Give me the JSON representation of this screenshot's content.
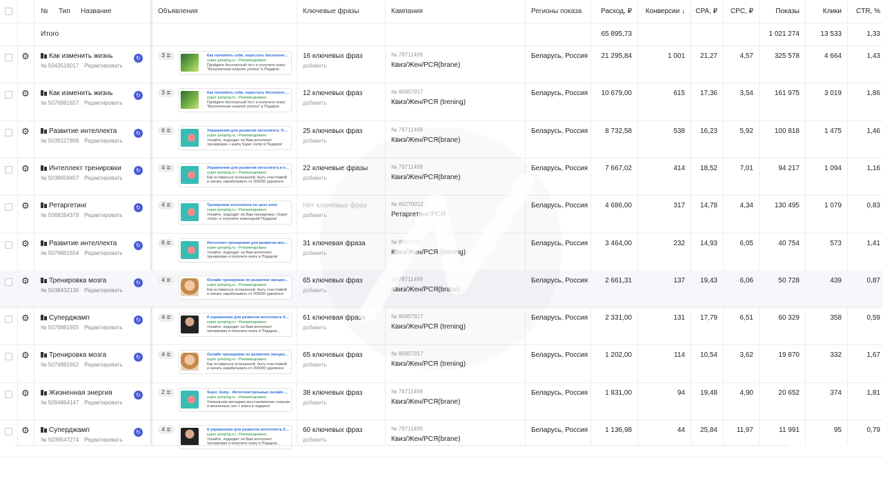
{
  "header": {
    "num": "№",
    "type": "Тип",
    "name": "Название",
    "ads": "Объявления",
    "keywords": "Ключевые фразы",
    "campaign": "Кампания",
    "regions": "Регионы показа",
    "spend": "Расход, ₽",
    "conversions": "Конверсии ↓",
    "cpa": "CPA, ₽",
    "cpc": "CPC, ₽",
    "impressions": "Показы",
    "clicks": "Клики",
    "ctr": "CTR, %"
  },
  "total": {
    "label": "Итого",
    "spend": "65 895,73",
    "impressions": "1 021 274",
    "clicks": "13 533",
    "ctr": "1,33"
  },
  "edit_label": "Редактировать",
  "add_label": "добавить",
  "rows": [
    {
      "name": "Как изменить жизнь",
      "id": "№ 5043518017",
      "ad_count": "3",
      "image": "green",
      "ad_title": "Как полюбить себя, перестать беспокоиться...",
      "ad_url": "super-jumping.ru › Рекомендовано",
      "ad_text": "Пройдите бесплатный тест и получите книгу \"Бесконечная энергия успеха\" в Подарок.",
      "keywords": "16 ключевых фраз",
      "campaign_id": "№ 78711499",
      "campaign": "Квиз/Жен/РСЯ(brane)",
      "regions": "Беларусь, Россия",
      "spend": "21 295,84",
      "conversions": "1 001",
      "cpa": "21,27",
      "cpc": "4,57",
      "impressions": "325 578",
      "clicks": "4 664",
      "ctr": "1,43"
    },
    {
      "name": "Как изменить жизнь",
      "id": "№ 5076881657",
      "ad_count": "3",
      "image": "green",
      "ad_title": "Как полюбить себя, перестать беспокоиться...",
      "ad_url": "super-jumping.ru › Рекомендовано",
      "ad_text": "Пройдите бесплатный тест и получите книгу \"Бесконечная энергия успеха\" в Подарок.",
      "keywords": "12 ключевых фраз",
      "campaign_id": "№ 80607917",
      "campaign": "Квиз/Жен/РСЯ (trening)",
      "regions": "Беларусь, Россия",
      "spend": "10 679,00",
      "conversions": "615",
      "cpa": "17,36",
      "cpc": "3,54",
      "impressions": "161 975",
      "clicks": "3 019",
      "ctr": "1,86"
    },
    {
      "name": "Развитие интеллекта",
      "id": "№ 5039127906",
      "ad_count": "6",
      "image": "teal",
      "ad_title": "Упражнения для развития интеллекта. Онла...",
      "ad_url": "super-jumping.ru › Рекомендовано",
      "ad_text": "Узнайте, подходит ли Вам интеллект тренировки + книга Super Jump в Подарок!",
      "keywords": "25 ключевых фраз",
      "campaign_id": "№ 78711499",
      "campaign": "Квиз/Жен/РСЯ(brane)",
      "regions": "Беларусь, Россия",
      "spend": "8 732,58",
      "conversions": "538",
      "cpa": "16,23",
      "cpc": "5,92",
      "impressions": "100 818",
      "clicks": "1 475",
      "ctr": "1,46"
    },
    {
      "name": "Интеллект тренировки",
      "id": "№ 5038659457",
      "ad_count": "4",
      "image": "teal",
      "ad_title": "Упражнения для развития интеллекта и памя...",
      "ad_url": "super-jumping.ru › Рекомендовано",
      "ad_text": "Как оставаться осознанной, быть счастливой и начать зарабатывать от 200000 удаленно",
      "keywords": "22 ключевые фразы",
      "campaign_id": "№ 78711499",
      "campaign": "Квиз/Жен/РСЯ(brane)",
      "regions": "Беларусь, Россия",
      "spend": "7 667,02",
      "conversions": "414",
      "cpa": "18,52",
      "cpc": "7,01",
      "impressions": "94 217",
      "clicks": "1 094",
      "ctr": "1,16"
    },
    {
      "name": "Ретаргетинг",
      "id": "№ 5068264378",
      "ad_count": "4",
      "image": "teal",
      "ad_title": "Тренировки интеллекта по цене алое",
      "ad_url": "super-jumping.ru › Рекомендовано",
      "ad_text": "Узнайте, подходит ли Вам тренировки «Super Jump» и получите новогодний Подарок!",
      "keywords": "Нет ключевых фраз",
      "keywords_muted": true,
      "campaign_id": "№ 80270012",
      "campaign": "Ретаргетинг/РСЯ",
      "regions": "Беларусь, Россия",
      "spend": "4 686,00",
      "conversions": "317",
      "cpa": "14,78",
      "cpc": "4,34",
      "impressions": "130 495",
      "clicks": "1 079",
      "ctr": "0,83"
    },
    {
      "name": "Развитие интеллекта",
      "id": "№ 5076881654",
      "ad_count": "6",
      "image": "teal",
      "ad_title": "Интеллект-тренировки для развития мозга и...",
      "ad_url": "super-jumping.ru › Рекомендовано",
      "ad_text": "Узнайте, подходит ли Вам интеллект тренировки и получите книгу в Подарок!",
      "keywords": "31 ключевая фраза",
      "campaign_id": "№ 80607917",
      "campaign": "Квиз/Жен/РСЯ (trening)",
      "regions": "Беларусь, Россия",
      "spend": "3 464,00",
      "conversions": "232",
      "cpa": "14,93",
      "cpc": "6,05",
      "impressions": "40 754",
      "clicks": "573",
      "ctr": "1,41"
    },
    {
      "name": "Тренировка мозга",
      "id": "№ 5038432130",
      "ad_count": "4",
      "image": "face",
      "highlight": true,
      "ad_title": "Онлайн тренировки по развитию эмоционал...",
      "ad_url": "super-jumping.ru › Рекомендовано",
      "ad_text": "Как оставаться осознанной, быть счастливой и начать зарабатывать от 200000 удаленно",
      "keywords": "65 ключевых фраз",
      "campaign_id": "№ 78711499",
      "campaign": "Квиз/Жен/РСЯ(brane)",
      "regions": "Беларусь, Россия",
      "spend": "2 661,31",
      "conversions": "137",
      "cpa": "19,43",
      "cpc": "6,06",
      "impressions": "50 728",
      "clicks": "439",
      "ctr": "0,87"
    },
    {
      "name": "Суперджамп",
      "id": "№ 5076881655",
      "ad_count": "4",
      "image": "man",
      "ad_title": "8 упражнения для развития интеллекта SUPE...",
      "ad_url": "super-jumping.ru › Рекомендовано",
      "ad_text": "Узнайте, подходит ли Вам интеллект тренировки и получите книгу в Подарок...",
      "keywords": "61 ключевая фраза",
      "campaign_id": "№ 80607917",
      "campaign": "Квиз/Жен/РСЯ (trening)",
      "regions": "Беларусь, Россия",
      "spend": "2 331,00",
      "conversions": "131",
      "cpa": "17,79",
      "cpc": "6,51",
      "impressions": "60 329",
      "clicks": "358",
      "ctr": "0,59"
    },
    {
      "name": "Тренировка мозга",
      "id": "№ 5076881652",
      "ad_count": "4",
      "image": "face",
      "ad_title": "Онлайн тренировки по развитию эмоционал...",
      "ad_url": "super-jumping.ru › Рекомендовано",
      "ad_text": "Как оставаться осознанной, быть счастливой и начать зарабатывать от 200000 удаленно",
      "keywords": "65 ключевых фраз",
      "campaign_id": "№ 80607917",
      "campaign": "Квиз/Жен/РСЯ (trening)",
      "regions": "Беларусь, Россия",
      "spend": "1 202,00",
      "conversions": "114",
      "cpa": "10,54",
      "cpc": "3,62",
      "impressions": "19 870",
      "clicks": "332",
      "ctr": "1,67"
    },
    {
      "name": "Жизненная энергия",
      "id": "№ 5094864147",
      "ad_count": "2",
      "image": "teal",
      "ad_title": "Super Jump - Интеллектуальные онлайн тре...",
      "ad_url": "super-jumping.ru › Рекомендовано",
      "ad_text": "Уникальная методика восстановления энергии и жизненных сил + книга в подарок!",
      "keywords": "38 ключевых фраз",
      "campaign_id": "№ 78711499",
      "campaign": "Квиз/Жен/РСЯ(brane)",
      "regions": "Беларусь, Россия",
      "spend": "1 831,00",
      "conversions": "94",
      "cpa": "19,48",
      "cpc": "4,90",
      "impressions": "20 652",
      "clicks": "374",
      "ctr": "1,81"
    },
    {
      "name": "Суперджамп",
      "id": "№ 5039547274",
      "ad_count": "4",
      "image": "man",
      "ad_title": "8 упражнения для развития интеллекта SUPE...",
      "ad_url": "super-jumping.ru › Рекомендовано",
      "ad_text": "Узнайте, подходит ли Вам интеллект тренировки и получите книгу в Подарок...",
      "keywords": "60 ключевых фраз",
      "campaign_id": "№ 78711499",
      "campaign": "Квиз/Жен/РСЯ(brane)",
      "regions": "Беларусь, Россия",
      "spend": "1 136,98",
      "conversions": "44",
      "cpa": "25,84",
      "cpc": "11,97",
      "impressions": "11 991",
      "clicks": "95",
      "ctr": "0,79"
    }
  ],
  "colors": {
    "badge": "#4a5bd4",
    "ad_title": "#2b6bd9",
    "ad_url": "#1a8a3a",
    "highlight": "#f5f7fa"
  }
}
